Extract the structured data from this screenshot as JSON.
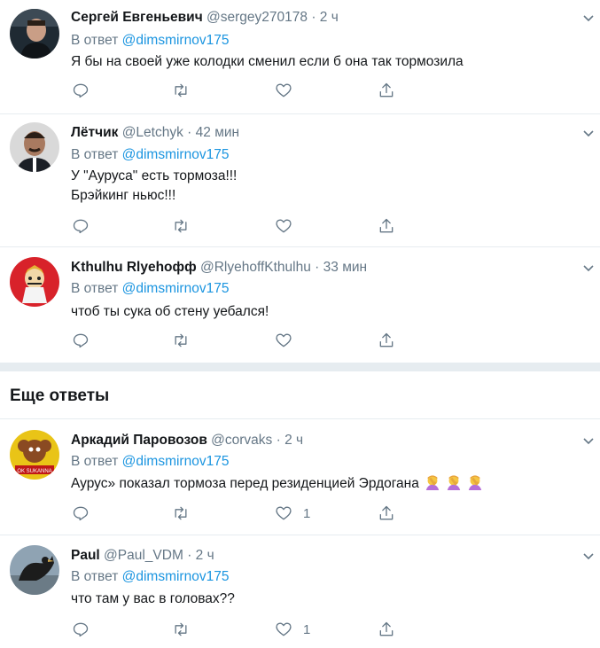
{
  "tweets": [
    {
      "name": "Сергей Евгеньевич",
      "handle": "@sergey270178",
      "dot": "·",
      "time": "2 ч",
      "reply_prefix": "В ответ",
      "reply_to": "@dimsmirnov175",
      "lines": [
        "Я бы на своей уже колодки сменил если б она так тормозила"
      ],
      "likes": ""
    },
    {
      "name": "Лётчик",
      "handle": "@Letchyk",
      "dot": "·",
      "time": "42 мин",
      "reply_prefix": "В ответ",
      "reply_to": "@dimsmirnov175",
      "lines": [
        "У \"Ауруса\" есть тормоза!!!",
        "Брэйкинг ньюс!!!"
      ],
      "likes": ""
    },
    {
      "name": "Kthulhu Rlyehoфф",
      "handle": "@RlyehoffKthulhu",
      "dot": "·",
      "time": "33 мин",
      "reply_prefix": "В ответ",
      "reply_to": "@dimsmirnov175",
      "lines": [
        "чтоб ты сука об стену уебался!"
      ],
      "likes": ""
    },
    {
      "name": "Аркадий Паровозов",
      "handle": "@corvaks",
      "dot": "·",
      "time": "2 ч",
      "reply_prefix": "В ответ",
      "reply_to": "@dimsmirnov175",
      "lines": [
        "Аурус» показал тормоза перед резиденцией Эрдогана"
      ],
      "likes": "1"
    },
    {
      "name": "Paul",
      "handle": "@Paul_VDM",
      "dot": "·",
      "time": "2 ч",
      "reply_prefix": "В ответ",
      "reply_to": "@dimsmirnov175",
      "lines": [
        "что там у вас в головах??"
      ],
      "likes": "1"
    }
  ],
  "section_title": "Еще ответы",
  "avatar4_text": "OK SUKANNA",
  "colors": {
    "accent": "#1b95e0",
    "muted": "#657786",
    "text": "#14171a",
    "divider": "#e6ecf0"
  }
}
